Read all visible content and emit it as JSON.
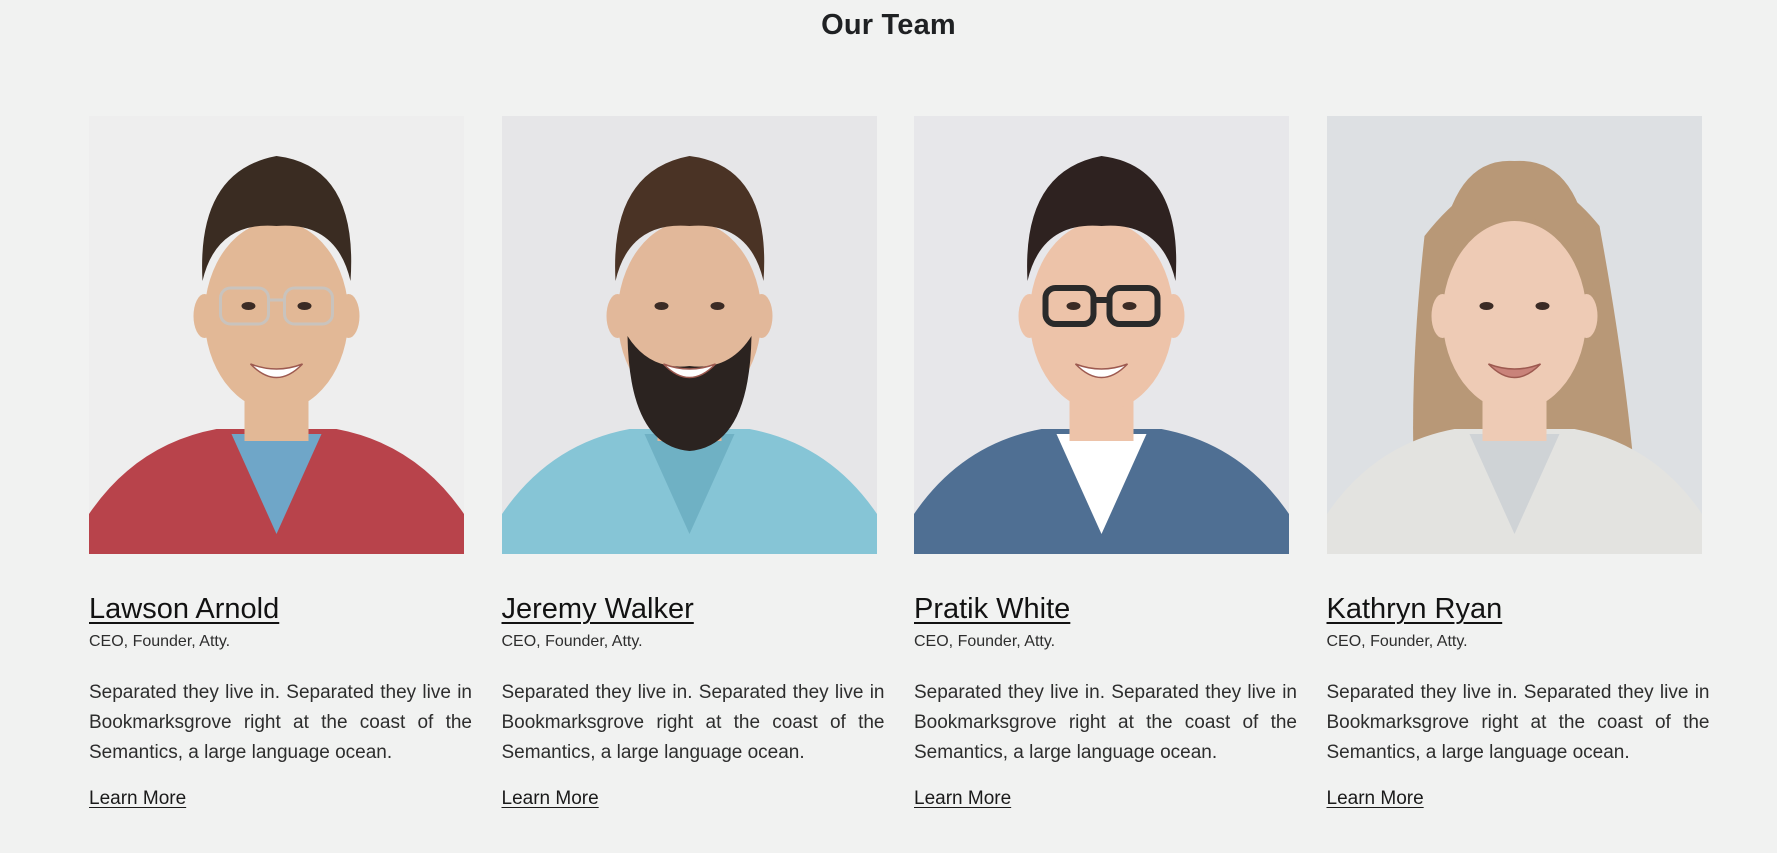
{
  "page": {
    "title": "Our Team"
  },
  "team": [
    {
      "name": "Lawson Arnold",
      "role": "CEO, Founder, Atty.",
      "bio": "Separated they live in. Separated they live in Bookmarksgrove right at the coast of the Semantics, a large language ocean.",
      "link_label": "Learn More",
      "photo": {
        "bg": "#eeeeee",
        "skin": "#e2b896",
        "hair": "#3a2c22",
        "shirt": "#b8434b",
        "shirt2": "#6fa6c8",
        "glasses": "light"
      }
    },
    {
      "name": "Jeremy Walker",
      "role": "CEO, Founder, Atty.",
      "bio": "Separated they live in. Separated they live in Bookmarksgrove right at the coast of the Semantics, a large language ocean.",
      "link_label": "Learn More",
      "photo": {
        "bg": "#e6e6e8",
        "skin": "#e2b89a",
        "hair": "#4a3325",
        "shirt": "#86c5d6",
        "shirt2": "#6fb1c4",
        "glasses": "none"
      }
    },
    {
      "name": "Pratik White",
      "role": "CEO, Founder, Atty.",
      "bio": "Separated they live in. Separated they live in Bookmarksgrove right at the coast of the Semantics, a large language ocean.",
      "link_label": "Learn More",
      "photo": {
        "bg": "#e7e7ea",
        "skin": "#edc3a9",
        "hair": "#2e2220",
        "shirt": "#4f6f93",
        "shirt2": "#ffffff",
        "glasses": "dark"
      }
    },
    {
      "name": "Kathryn Ryan",
      "role": "CEO, Founder, Atty.",
      "bio": "Separated they live in. Separated they live in Bookmarksgrove right at the coast of the Semantics, a large language ocean.",
      "link_label": "Learn More",
      "photo": {
        "bg": "#dde0e3",
        "skin": "#eecbb5",
        "hair": "#b89877",
        "shirt": "#e3e3e0",
        "shirt2": "#cfd3d6",
        "glasses": "none"
      }
    }
  ]
}
